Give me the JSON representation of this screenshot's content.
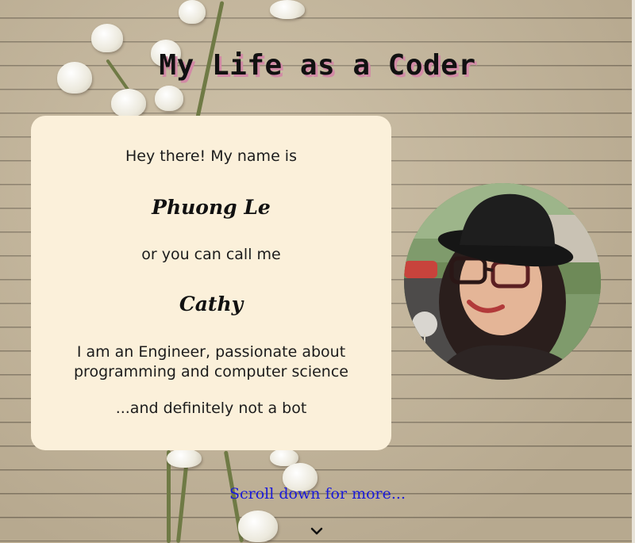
{
  "page": {
    "title": "My Life as a Coder"
  },
  "intro_card": {
    "greeting": "Hey there! My name is",
    "name": "Phuong Le",
    "alias_prompt": "or you can call me",
    "nickname": "Cathy",
    "bio_line_1": "I am an Engineer, passionate about",
    "bio_line_2": "programming and computer science",
    "closing": "...and definitely not a bot"
  },
  "scroll_hint": {
    "label": "Scroll down for more...",
    "icon": "chevron-down-icon"
  },
  "colors": {
    "title_shadow": "#d28aa6",
    "card_background": "#fbf0da",
    "link": "#1a1ad9"
  }
}
